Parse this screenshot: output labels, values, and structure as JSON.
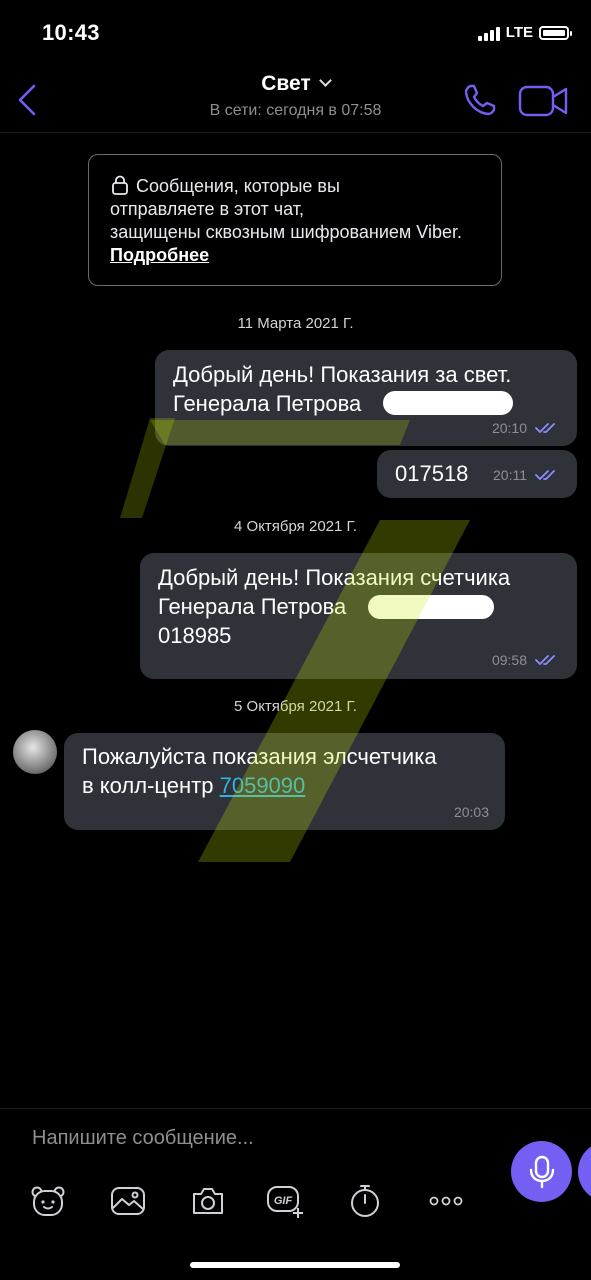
{
  "status_bar": {
    "time": "10:43",
    "network": "LTE"
  },
  "header": {
    "title": "Свет",
    "subtitle": "В сети: сегодня в 07:58"
  },
  "notice": {
    "text": "Сообщения, которые вы отправляете в этот чат, защищены сквозным шифрованием Viber.",
    "lines": [
      "Сообщения, которые вы",
      "отправляете в этот чат,",
      "защищены сквозным",
      "шифрованием Viber."
    ],
    "link": "Подробнее"
  },
  "dates": [
    "11 Марта 2021 Г.",
    "4 Октября 2021 Г.",
    "5 Октября 2021 Г."
  ],
  "messages": [
    {
      "direction": "outgoing",
      "lines": [
        "Добрый день! Показания за свет.",
        "Генерала Петрова"
      ],
      "time": "20:10",
      "read": true
    },
    {
      "direction": "outgoing",
      "lines": [
        "017518"
      ],
      "time": "20:11",
      "read": true
    },
    {
      "direction": "outgoing",
      "lines": [
        "Добрый день! Показания счетчика",
        "Генерала Петрова",
        "018985"
      ],
      "time": "09:58",
      "read": true
    },
    {
      "direction": "incoming",
      "lines": [
        "Пожалуйста показания элсчетчика",
        "в колл-центр"
      ],
      "link": "7059090",
      "time": "20:03"
    }
  ],
  "composer": {
    "placeholder": "Напишите сообщение...",
    "gif_label": "GIF"
  },
  "colors": {
    "accent": "#7360f2",
    "bubble": "#2f3339",
    "link": "#33b1de",
    "watermark": "#c8e600"
  }
}
